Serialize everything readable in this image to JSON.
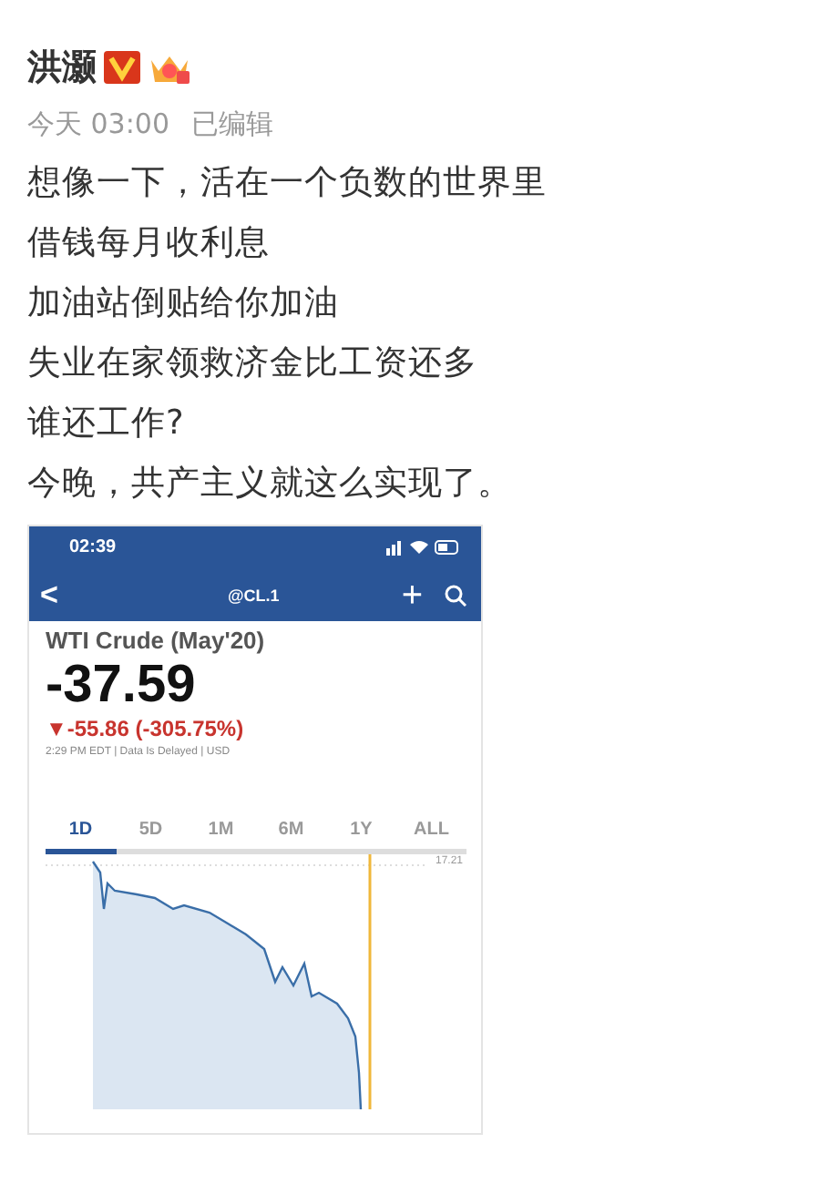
{
  "post": {
    "author": "洪灏",
    "time": "今天 03:00",
    "edited": "已编辑",
    "lines": [
      "想像一下，活在一个负数的世界里",
      "借钱每月收利息",
      "加油站倒贴给你加油",
      "失业在家领救济金比工资还多",
      "谁还工作?",
      "今晚，共产主义就这么实现了。"
    ]
  },
  "screenshot": {
    "status_time": "02:39",
    "nav_title": "@CL.1",
    "back": "<",
    "add": "+",
    "instrument": "WTI Crude (May'20)",
    "price": "-37.59",
    "change": "▼-55.86 (-305.75%)",
    "note": "2:29 PM EDT | Data Is Delayed | USD",
    "ranges": [
      {
        "label": "1D",
        "selected": true
      },
      {
        "label": "5D",
        "selected": false
      },
      {
        "label": "1M",
        "selected": false
      },
      {
        "label": "6M",
        "selected": false
      },
      {
        "label": "1Y",
        "selected": false
      },
      {
        "label": "ALL",
        "selected": false
      }
    ],
    "price_label": "17.21"
  }
}
